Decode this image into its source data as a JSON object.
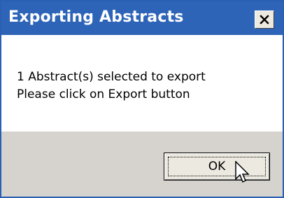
{
  "dialog": {
    "title": "Exporting Abstracts",
    "message_line1": "1 Abstract(s) selected to export",
    "message_line2": "Please click on Export button",
    "ok_label": "OK"
  },
  "icons": {
    "close": "close-icon",
    "cursor": "mouse-pointer-icon"
  },
  "colors": {
    "titlebar": "#2d64b8",
    "footer": "#d6d3ce",
    "button_face": "#ece9e1"
  }
}
